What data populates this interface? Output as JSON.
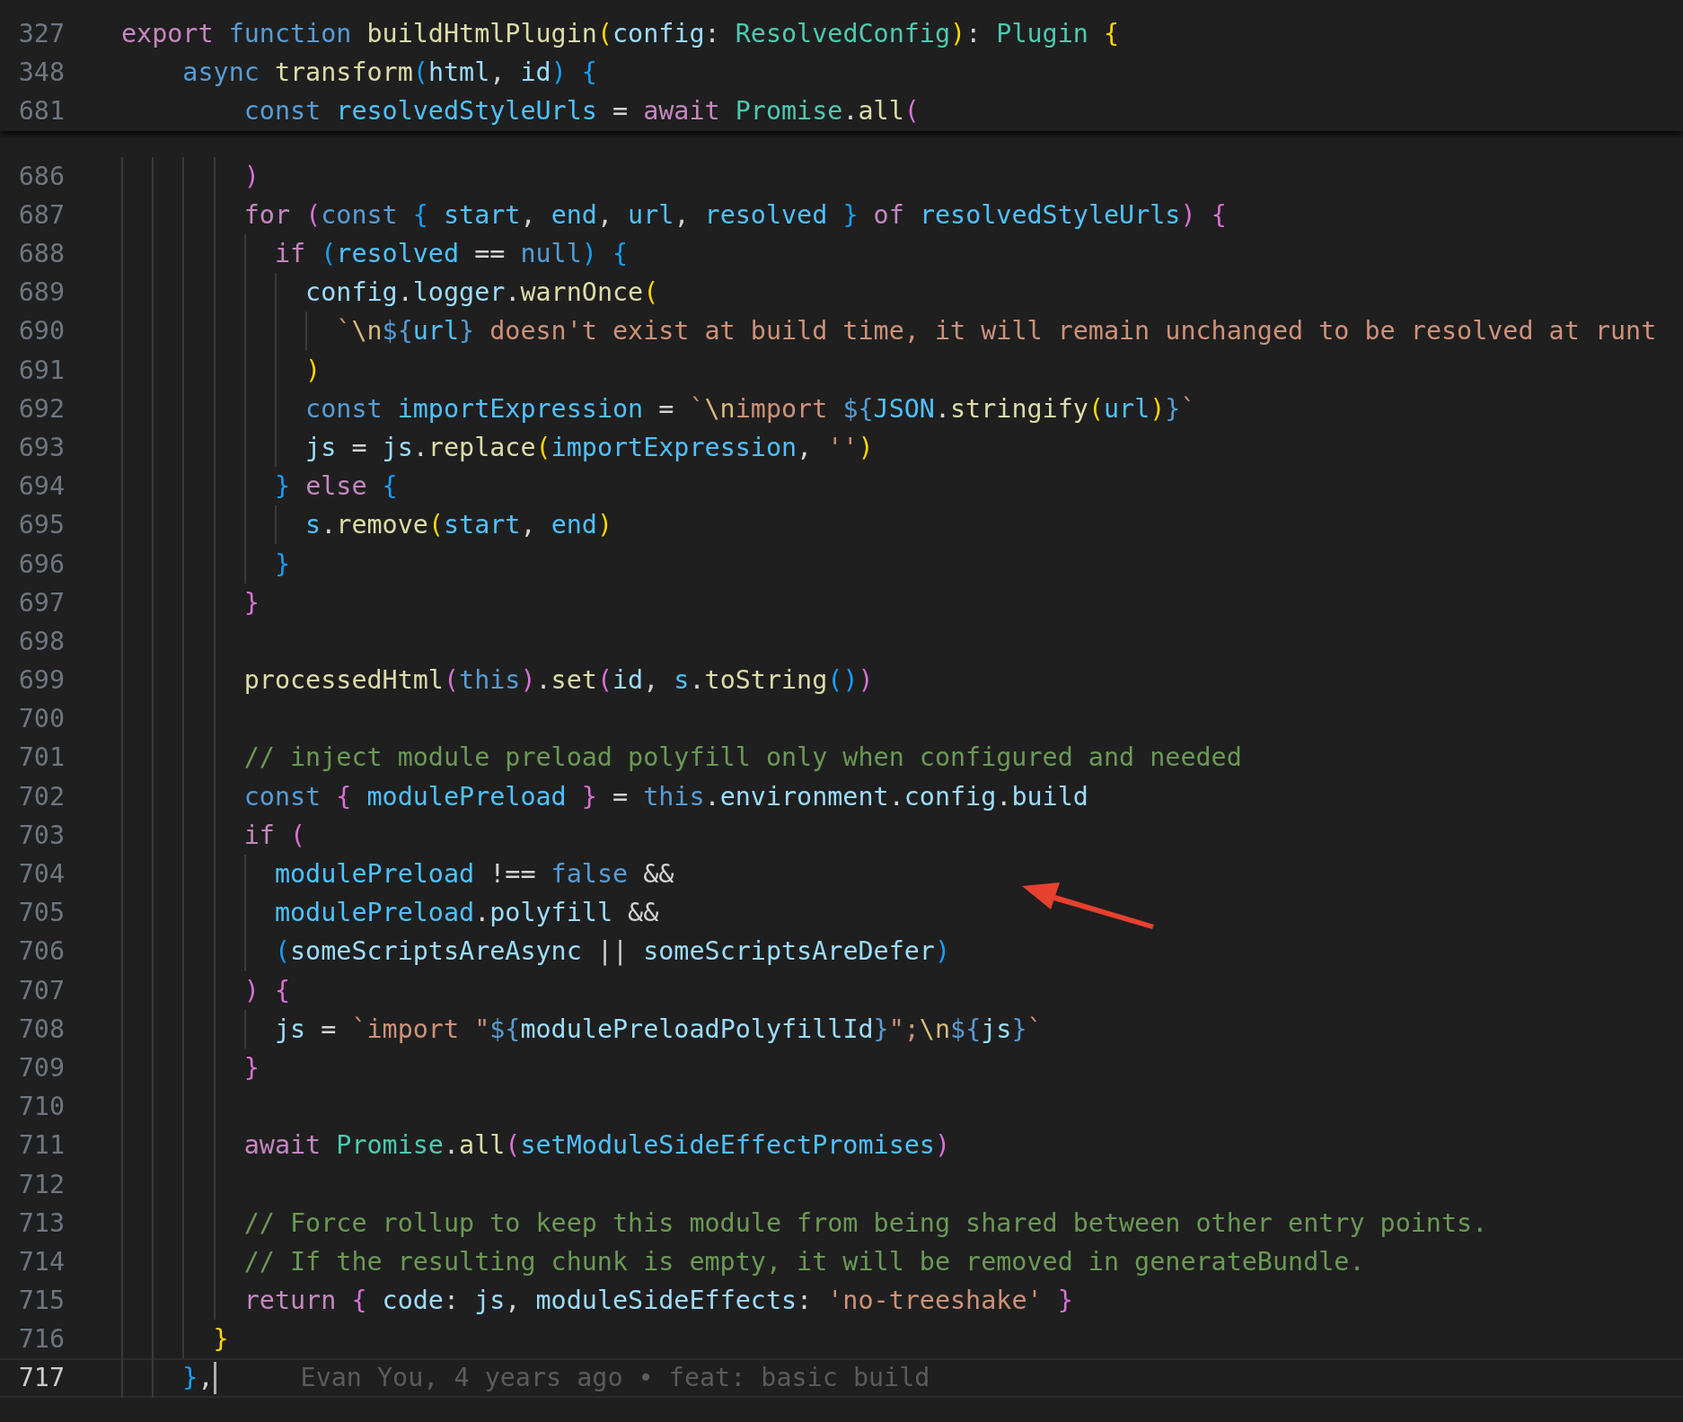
{
  "sticky_scroll": [
    {
      "number": "327",
      "tokens": [
        {
          "text": "export ",
          "kind": "ctrl"
        },
        {
          "text": "function ",
          "kind": "kw"
        },
        {
          "text": "buildHtmlPlugin",
          "kind": "fn"
        },
        {
          "text": "(",
          "kind": "b1"
        },
        {
          "text": "config",
          "kind": "var"
        },
        {
          "text": ": ",
          "kind": "p"
        },
        {
          "text": "ResolvedConfig",
          "kind": "type"
        },
        {
          "text": ")",
          "kind": "b1"
        },
        {
          "text": ": ",
          "kind": "p"
        },
        {
          "text": "Plugin ",
          "kind": "type"
        },
        {
          "text": "{",
          "kind": "b1"
        }
      ]
    },
    {
      "number": "348",
      "tokens": [
        {
          "text": "    async ",
          "kind": "kw"
        },
        {
          "text": "transform",
          "kind": "fn"
        },
        {
          "text": "(",
          "kind": "b3"
        },
        {
          "text": "html",
          "kind": "var"
        },
        {
          "text": ", ",
          "kind": "p"
        },
        {
          "text": "id",
          "kind": "var"
        },
        {
          "text": ") {",
          "kind": "b3"
        }
      ]
    },
    {
      "number": "681",
      "tokens": [
        {
          "text": "        const ",
          "kind": "kw"
        },
        {
          "text": "resolvedStyleUrls",
          "kind": "const"
        },
        {
          "text": " = ",
          "kind": "p"
        },
        {
          "text": "await ",
          "kind": "ctrl"
        },
        {
          "text": "Promise",
          "kind": "type"
        },
        {
          "text": ".",
          "kind": "p"
        },
        {
          "text": "all",
          "kind": "fn"
        },
        {
          "text": "(",
          "kind": "b2"
        }
      ]
    }
  ],
  "lines": [
    {
      "number": "686",
      "current": false,
      "tokens": [
        {
          "text": "        )",
          "kind": "b2"
        }
      ]
    },
    {
      "number": "687",
      "current": false,
      "tokens": [
        {
          "text": "        for ",
          "kind": "ctrl"
        },
        {
          "text": "(",
          "kind": "b2"
        },
        {
          "text": "const ",
          "kind": "kw"
        },
        {
          "text": "{ ",
          "kind": "b3"
        },
        {
          "text": "start",
          "kind": "const"
        },
        {
          "text": ", ",
          "kind": "p"
        },
        {
          "text": "end",
          "kind": "const"
        },
        {
          "text": ", ",
          "kind": "p"
        },
        {
          "text": "url",
          "kind": "const"
        },
        {
          "text": ", ",
          "kind": "p"
        },
        {
          "text": "resolved ",
          "kind": "const"
        },
        {
          "text": "} ",
          "kind": "b3"
        },
        {
          "text": "of ",
          "kind": "ctrl"
        },
        {
          "text": "resolvedStyleUrls",
          "kind": "const"
        },
        {
          "text": ") {",
          "kind": "b2"
        }
      ]
    },
    {
      "number": "688",
      "current": false,
      "tokens": [
        {
          "text": "          if ",
          "kind": "ctrl"
        },
        {
          "text": "(",
          "kind": "b3"
        },
        {
          "text": "resolved",
          "kind": "const"
        },
        {
          "text": " == ",
          "kind": "p"
        },
        {
          "text": "null",
          "kind": "kw"
        },
        {
          "text": ") {",
          "kind": "b3"
        }
      ]
    },
    {
      "number": "689",
      "current": false,
      "tokens": [
        {
          "text": "            config",
          "kind": "var"
        },
        {
          "text": ".",
          "kind": "p"
        },
        {
          "text": "logger",
          "kind": "var"
        },
        {
          "text": ".",
          "kind": "p"
        },
        {
          "text": "warnOnce",
          "kind": "fn"
        },
        {
          "text": "(",
          "kind": "b1"
        }
      ]
    },
    {
      "number": "690",
      "current": false,
      "tokens": [
        {
          "text": "              `",
          "kind": "str"
        },
        {
          "text": "\\n",
          "kind": "esc"
        },
        {
          "text": "${",
          "kind": "tpl"
        },
        {
          "text": "url",
          "kind": "const"
        },
        {
          "text": "}",
          "kind": "tpl"
        },
        {
          "text": " doesn't exist at build time, it will remain unchanged to be resolved at runt",
          "kind": "str"
        }
      ]
    },
    {
      "number": "691",
      "current": false,
      "tokens": [
        {
          "text": "            )",
          "kind": "b1"
        }
      ]
    },
    {
      "number": "692",
      "current": false,
      "tokens": [
        {
          "text": "            const ",
          "kind": "kw"
        },
        {
          "text": "importExpression",
          "kind": "const"
        },
        {
          "text": " = ",
          "kind": "p"
        },
        {
          "text": "`",
          "kind": "str"
        },
        {
          "text": "\\n",
          "kind": "esc"
        },
        {
          "text": "import ",
          "kind": "str"
        },
        {
          "text": "${",
          "kind": "tpl"
        },
        {
          "text": "JSON",
          "kind": "const"
        },
        {
          "text": ".",
          "kind": "p"
        },
        {
          "text": "stringify",
          "kind": "fn"
        },
        {
          "text": "(",
          "kind": "b1"
        },
        {
          "text": "url",
          "kind": "const"
        },
        {
          "text": ")",
          "kind": "b1"
        },
        {
          "text": "}",
          "kind": "tpl"
        },
        {
          "text": "`",
          "kind": "str"
        }
      ]
    },
    {
      "number": "693",
      "current": false,
      "tokens": [
        {
          "text": "            js",
          "kind": "var"
        },
        {
          "text": " = ",
          "kind": "p"
        },
        {
          "text": "js",
          "kind": "var"
        },
        {
          "text": ".",
          "kind": "p"
        },
        {
          "text": "replace",
          "kind": "fn"
        },
        {
          "text": "(",
          "kind": "b1"
        },
        {
          "text": "importExpression",
          "kind": "const"
        },
        {
          "text": ", ",
          "kind": "p"
        },
        {
          "text": "''",
          "kind": "str"
        },
        {
          "text": ")",
          "kind": "b1"
        }
      ]
    },
    {
      "number": "694",
      "current": false,
      "tokens": [
        {
          "text": "          } ",
          "kind": "b3"
        },
        {
          "text": "else ",
          "kind": "ctrl"
        },
        {
          "text": "{",
          "kind": "b3"
        }
      ]
    },
    {
      "number": "695",
      "current": false,
      "tokens": [
        {
          "text": "            s",
          "kind": "const"
        },
        {
          "text": ".",
          "kind": "p"
        },
        {
          "text": "remove",
          "kind": "fn"
        },
        {
          "text": "(",
          "kind": "b1"
        },
        {
          "text": "start",
          "kind": "const"
        },
        {
          "text": ", ",
          "kind": "p"
        },
        {
          "text": "end",
          "kind": "const"
        },
        {
          "text": ")",
          "kind": "b1"
        }
      ]
    },
    {
      "number": "696",
      "current": false,
      "tokens": [
        {
          "text": "          }",
          "kind": "b3"
        }
      ]
    },
    {
      "number": "697",
      "current": false,
      "tokens": [
        {
          "text": "        }",
          "kind": "b2"
        }
      ]
    },
    {
      "number": "698",
      "current": false
    },
    {
      "number": "699",
      "current": false,
      "tokens": [
        {
          "text": "        processedHtml",
          "kind": "fn"
        },
        {
          "text": "(",
          "kind": "b2"
        },
        {
          "text": "this",
          "kind": "kw"
        },
        {
          "text": ")",
          "kind": "b2"
        },
        {
          "text": ".",
          "kind": "p"
        },
        {
          "text": "set",
          "kind": "fn"
        },
        {
          "text": "(",
          "kind": "b2"
        },
        {
          "text": "id",
          "kind": "var"
        },
        {
          "text": ", ",
          "kind": "p"
        },
        {
          "text": "s",
          "kind": "const"
        },
        {
          "text": ".",
          "kind": "p"
        },
        {
          "text": "toString",
          "kind": "fn"
        },
        {
          "text": "()",
          "kind": "b3"
        },
        {
          "text": ")",
          "kind": "b2"
        }
      ]
    },
    {
      "number": "700",
      "current": false
    },
    {
      "number": "701",
      "current": false,
      "tokens": [
        {
          "text": "        // inject module preload polyfill only when configured and needed",
          "kind": "cmt"
        }
      ]
    },
    {
      "number": "702",
      "current": false,
      "tokens": [
        {
          "text": "        const ",
          "kind": "kw"
        },
        {
          "text": "{ ",
          "kind": "b2"
        },
        {
          "text": "modulePreload ",
          "kind": "const"
        },
        {
          "text": "}",
          "kind": "b2"
        },
        {
          "text": " = ",
          "kind": "p"
        },
        {
          "text": "this",
          "kind": "kw"
        },
        {
          "text": ".",
          "kind": "p"
        },
        {
          "text": "environment",
          "kind": "var"
        },
        {
          "text": ".",
          "kind": "p"
        },
        {
          "text": "config",
          "kind": "var"
        },
        {
          "text": ".",
          "kind": "p"
        },
        {
          "text": "build",
          "kind": "var"
        }
      ]
    },
    {
      "number": "703",
      "current": false,
      "tokens": [
        {
          "text": "        if ",
          "kind": "ctrl"
        },
        {
          "text": "(",
          "kind": "b2"
        }
      ]
    },
    {
      "number": "704",
      "current": false,
      "tokens": [
        {
          "text": "          modulePreload",
          "kind": "const"
        },
        {
          "text": " !== ",
          "kind": "p"
        },
        {
          "text": "false",
          "kind": "kw"
        },
        {
          "text": " &&",
          "kind": "p"
        }
      ]
    },
    {
      "number": "705",
      "current": false,
      "tokens": [
        {
          "text": "          modulePreload",
          "kind": "const"
        },
        {
          "text": ".",
          "kind": "p"
        },
        {
          "text": "polyfill",
          "kind": "var"
        },
        {
          "text": " &&",
          "kind": "p"
        }
      ]
    },
    {
      "number": "706",
      "current": false,
      "tokens": [
        {
          "text": "          (",
          "kind": "b3"
        },
        {
          "text": "someScriptsAreAsync",
          "kind": "var"
        },
        {
          "text": " || ",
          "kind": "p"
        },
        {
          "text": "someScriptsAreDefer",
          "kind": "var"
        },
        {
          "text": ")",
          "kind": "b3"
        }
      ]
    },
    {
      "number": "707",
      "current": false,
      "tokens": [
        {
          "text": "        ) {",
          "kind": "b2"
        }
      ]
    },
    {
      "number": "708",
      "current": false,
      "tokens": [
        {
          "text": "          js",
          "kind": "var"
        },
        {
          "text": " = ",
          "kind": "p"
        },
        {
          "text": "`import \"",
          "kind": "str"
        },
        {
          "text": "${",
          "kind": "tpl"
        },
        {
          "text": "modulePreloadPolyfillId",
          "kind": "var"
        },
        {
          "text": "}",
          "kind": "tpl"
        },
        {
          "text": "\";",
          "kind": "str"
        },
        {
          "text": "\\n",
          "kind": "esc"
        },
        {
          "text": "${",
          "kind": "tpl"
        },
        {
          "text": "js",
          "kind": "var"
        },
        {
          "text": "}",
          "kind": "tpl"
        },
        {
          "text": "`",
          "kind": "str"
        }
      ]
    },
    {
      "number": "709",
      "current": false,
      "tokens": [
        {
          "text": "        }",
          "kind": "b2"
        }
      ]
    },
    {
      "number": "710",
      "current": false
    },
    {
      "number": "711",
      "current": false,
      "tokens": [
        {
          "text": "        await ",
          "kind": "ctrl"
        },
        {
          "text": "Promise",
          "kind": "type"
        },
        {
          "text": ".",
          "kind": "p"
        },
        {
          "text": "all",
          "kind": "fn"
        },
        {
          "text": "(",
          "kind": "b2"
        },
        {
          "text": "setModuleSideEffectPromises",
          "kind": "const"
        },
        {
          "text": ")",
          "kind": "b2"
        }
      ]
    },
    {
      "number": "712",
      "current": false
    },
    {
      "number": "713",
      "current": false,
      "tokens": [
        {
          "text": "        // Force rollup to keep this module from being shared between other entry points.",
          "kind": "cmt"
        }
      ]
    },
    {
      "number": "714",
      "current": false,
      "tokens": [
        {
          "text": "        // If the resulting chunk is empty, it will be removed in generateBundle.",
          "kind": "cmt"
        }
      ]
    },
    {
      "number": "715",
      "current": false,
      "tokens": [
        {
          "text": "        return ",
          "kind": "ctrl"
        },
        {
          "text": "{ ",
          "kind": "b2"
        },
        {
          "text": "code",
          "kind": "var"
        },
        {
          "text": ": ",
          "kind": "p"
        },
        {
          "text": "js",
          "kind": "var"
        },
        {
          "text": ", ",
          "kind": "p"
        },
        {
          "text": "moduleSideEffects",
          "kind": "var"
        },
        {
          "text": ": ",
          "kind": "p"
        },
        {
          "text": "'no-treeshake' ",
          "kind": "str"
        },
        {
          "text": "}",
          "kind": "b2"
        }
      ]
    },
    {
      "number": "716",
      "current": false,
      "tokens": [
        {
          "text": "      }",
          "kind": "b1"
        }
      ]
    },
    {
      "number": "717",
      "current": true,
      "tokens": [
        {
          "text": "    }",
          "kind": "b3"
        },
        {
          "text": ",",
          "kind": "p"
        }
      ],
      "blame": "Evan You, 4 years ago • feat: basic build"
    }
  ]
}
